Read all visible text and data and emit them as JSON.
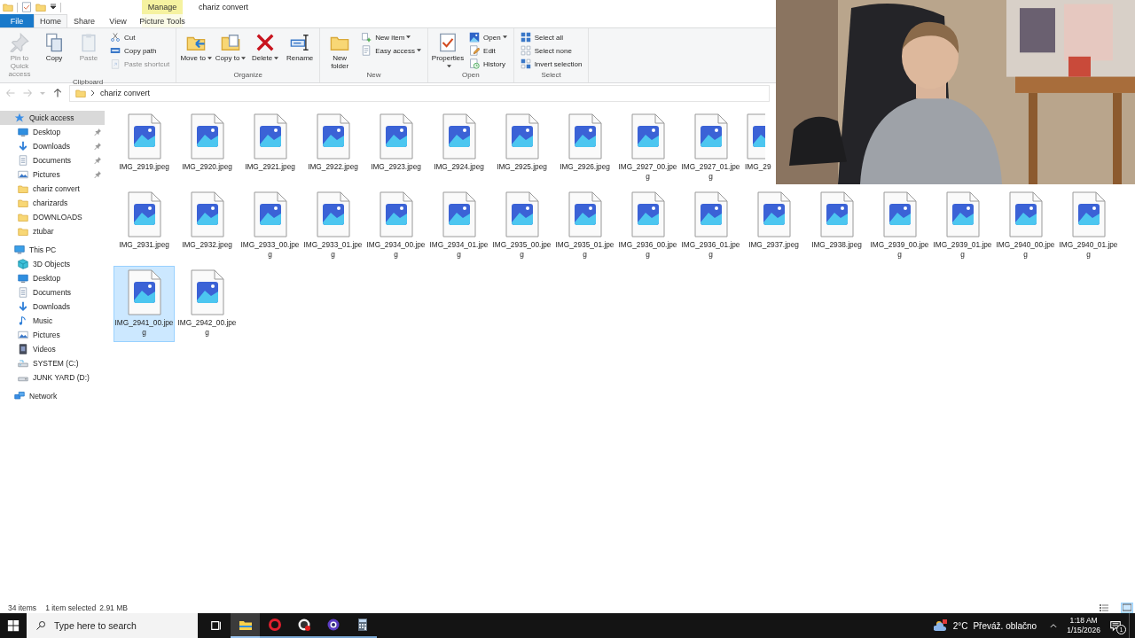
{
  "title_bar": {
    "context_group": "Manage",
    "title": "chariz convert"
  },
  "tabs": [
    {
      "label": "File",
      "kind": "file",
      "selected": false
    },
    {
      "label": "Home",
      "kind": "normal",
      "selected": true
    },
    {
      "label": "Share",
      "kind": "normal",
      "selected": false
    },
    {
      "label": "View",
      "kind": "normal",
      "selected": false
    },
    {
      "label": "Picture Tools",
      "kind": "context",
      "selected": false
    }
  ],
  "ribbon": {
    "groups": [
      {
        "name": "Clipboard",
        "commands": [
          {
            "label": "Pin to Quick access",
            "kind": "large",
            "dropdown": false,
            "disabled": true
          },
          {
            "label": "Copy",
            "kind": "large",
            "dropdown": false,
            "disabled": false
          },
          {
            "label": "Paste",
            "kind": "large",
            "dropdown": false,
            "disabled": true
          },
          {
            "label": "Cut",
            "kind": "small",
            "dropdown": false,
            "disabled": false
          },
          {
            "label": "Copy path",
            "kind": "small",
            "dropdown": false,
            "disabled": false
          },
          {
            "label": "Paste shortcut",
            "kind": "small",
            "dropdown": false,
            "disabled": true
          }
        ]
      },
      {
        "name": "Organize",
        "commands": [
          {
            "label": "Move to",
            "kind": "large",
            "dropdown": true,
            "disabled": false
          },
          {
            "label": "Copy to",
            "kind": "large",
            "dropdown": true,
            "disabled": false
          },
          {
            "label": "Delete",
            "kind": "large",
            "dropdown": true,
            "disabled": false
          },
          {
            "label": "Rename",
            "kind": "large",
            "dropdown": false,
            "disabled": false
          }
        ]
      },
      {
        "name": "New",
        "commands": [
          {
            "label": "New folder",
            "kind": "large",
            "dropdown": false,
            "disabled": false
          },
          {
            "label": "New item",
            "kind": "small",
            "dropdown": true,
            "disabled": false
          },
          {
            "label": "Easy access",
            "kind": "small",
            "dropdown": true,
            "disabled": false
          }
        ]
      },
      {
        "name": "Open",
        "commands": [
          {
            "label": "Properties",
            "kind": "large",
            "dropdown": true,
            "disabled": false
          },
          {
            "label": "Open",
            "kind": "small",
            "dropdown": true,
            "disabled": false
          },
          {
            "label": "Edit",
            "kind": "small",
            "dropdown": false,
            "disabled": false
          },
          {
            "label": "History",
            "kind": "small",
            "dropdown": false,
            "disabled": false
          }
        ]
      },
      {
        "name": "Select",
        "commands": [
          {
            "label": "Select all",
            "kind": "small",
            "dropdown": false,
            "disabled": false
          },
          {
            "label": "Select none",
            "kind": "small",
            "dropdown": false,
            "disabled": false
          },
          {
            "label": "Invert selection",
            "kind": "small",
            "dropdown": false,
            "disabled": false
          }
        ]
      }
    ]
  },
  "address_bar": {
    "crumbs": [
      {
        "label": "chariz convert"
      }
    ]
  },
  "navigation": [
    {
      "label": "Quick access",
      "kind": "star",
      "selected": true,
      "children": [
        {
          "label": "Desktop",
          "kind": "desktop",
          "pinned": true,
          "selected": false
        },
        {
          "label": "Downloads",
          "kind": "downloads",
          "pinned": true,
          "selected": false
        },
        {
          "label": "Documents",
          "kind": "documents",
          "pinned": true,
          "selected": false
        },
        {
          "label": "Pictures",
          "kind": "pictures",
          "pinned": true,
          "selected": false
        },
        {
          "label": "chariz convert",
          "kind": "folder",
          "pinned": false,
          "selected": false
        },
        {
          "label": "charizards",
          "kind": "folder",
          "pinned": false,
          "selected": false
        },
        {
          "label": "DOWNLOADS",
          "kind": "folder",
          "pinned": false,
          "selected": false
        },
        {
          "label": "ztubar",
          "kind": "folder",
          "pinned": false,
          "selected": false
        }
      ]
    },
    {
      "label": "This PC",
      "kind": "pc",
      "selected": false,
      "children": [
        {
          "label": "3D Objects",
          "kind": "objects3d",
          "pinned": false,
          "selected": false
        },
        {
          "label": "Desktop",
          "kind": "desktop",
          "pinned": false,
          "selected": false
        },
        {
          "label": "Documents",
          "kind": "documents",
          "pinned": false,
          "selected": false
        },
        {
          "label": "Downloads",
          "kind": "downloads",
          "pinned": false,
          "selected": false
        },
        {
          "label": "Music",
          "kind": "music",
          "pinned": false,
          "selected": false
        },
        {
          "label": "Pictures",
          "kind": "pictures",
          "pinned": false,
          "selected": false
        },
        {
          "label": "Videos",
          "kind": "videos",
          "pinned": false,
          "selected": false
        },
        {
          "label": "SYSTEM (C:)",
          "kind": "drive_c",
          "pinned": false,
          "selected": false
        },
        {
          "label": "JUNK YARD (D:)",
          "kind": "drive",
          "pinned": false,
          "selected": false
        }
      ]
    },
    {
      "label": "Network",
      "kind": "network",
      "selected": false
    }
  ],
  "file_rows": [
    [
      {
        "name": "IMG_2919.jpeg",
        "selected": false,
        "clipped": false
      },
      {
        "name": "IMG_2920.jpeg",
        "selected": false,
        "clipped": false
      },
      {
        "name": "IMG_2921.jpeg",
        "selected": false,
        "clipped": false
      },
      {
        "name": "IMG_2922.jpeg",
        "selected": false,
        "clipped": false
      },
      {
        "name": "IMG_2923.jpeg",
        "selected": false,
        "clipped": false
      },
      {
        "name": "IMG_2924.jpeg",
        "selected": false,
        "clipped": false
      },
      {
        "name": "IMG_2925.jpeg",
        "selected": false,
        "clipped": false
      },
      {
        "name": "IMG_2926.jpeg",
        "selected": false,
        "clipped": false
      },
      {
        "name": "IMG_2927_00.jpeg",
        "selected": false,
        "clipped": false
      },
      {
        "name": "IMG_2927_01.jpeg",
        "selected": false,
        "clipped": false
      },
      {
        "name": "IMG_29",
        "selected": false,
        "clipped": true
      }
    ],
    [
      {
        "name": "IMG_2931.jpeg",
        "selected": false,
        "clipped": false
      },
      {
        "name": "IMG_2932.jpeg",
        "selected": false,
        "clipped": false
      },
      {
        "name": "IMG_2933_00.jpeg",
        "selected": false,
        "clipped": false
      },
      {
        "name": "IMG_2933_01.jpeg",
        "selected": false,
        "clipped": false
      },
      {
        "name": "IMG_2934_00.jpeg",
        "selected": false,
        "clipped": false
      },
      {
        "name": "IMG_2934_01.jpeg",
        "selected": false,
        "clipped": false
      },
      {
        "name": "IMG_2935_00.jpeg",
        "selected": false,
        "clipped": false
      },
      {
        "name": "IMG_2935_01.jpeg",
        "selected": false,
        "clipped": false
      },
      {
        "name": "IMG_2936_00.jpeg",
        "selected": false,
        "clipped": false
      },
      {
        "name": "IMG_2936_01.jpeg",
        "selected": false,
        "clipped": false
      },
      {
        "name": "IMG_2937.jpeg",
        "selected": false,
        "clipped": false
      },
      {
        "name": "IMG_2938.jpeg",
        "selected": false,
        "clipped": false
      },
      {
        "name": "IMG_2939_00.jpeg",
        "selected": false,
        "clipped": false
      },
      {
        "name": "IMG_2939_01.jpeg",
        "selected": false,
        "clipped": false
      },
      {
        "name": "IMG_2940_00.jpeg",
        "selected": false,
        "clipped": false
      },
      {
        "name": "IMG_2940_01.jpeg",
        "selected": false,
        "clipped": false
      }
    ],
    [
      {
        "name": "IMG_2941_00.jpeg",
        "selected": true,
        "clipped": false
      },
      {
        "name": "IMG_2942_00.jpeg",
        "selected": false,
        "clipped": false
      }
    ]
  ],
  "status_bar": {
    "item_count": "34 items",
    "selection": "1 item selected",
    "size": "2.91 MB",
    "view_buttons": [
      {
        "selected": false
      },
      {
        "selected": true
      }
    ]
  },
  "taskbar": {
    "search_placeholder": "Type here to search",
    "apps": [
      {
        "kind": "explorer",
        "selected": true
      },
      {
        "kind": "opera",
        "selected": false
      },
      {
        "kind": "obs",
        "selected": false
      },
      {
        "kind": "orb",
        "selected": false
      },
      {
        "kind": "calculator",
        "selected": false
      }
    ],
    "weather": {
      "temperature": "2°C",
      "condition": "Převáž. oblačno"
    },
    "clock": {
      "time": "1:18 AM",
      "date": "1/15/2026"
    },
    "notifications": {
      "count": "1"
    }
  },
  "webcam": {
    "kind": "picture"
  }
}
